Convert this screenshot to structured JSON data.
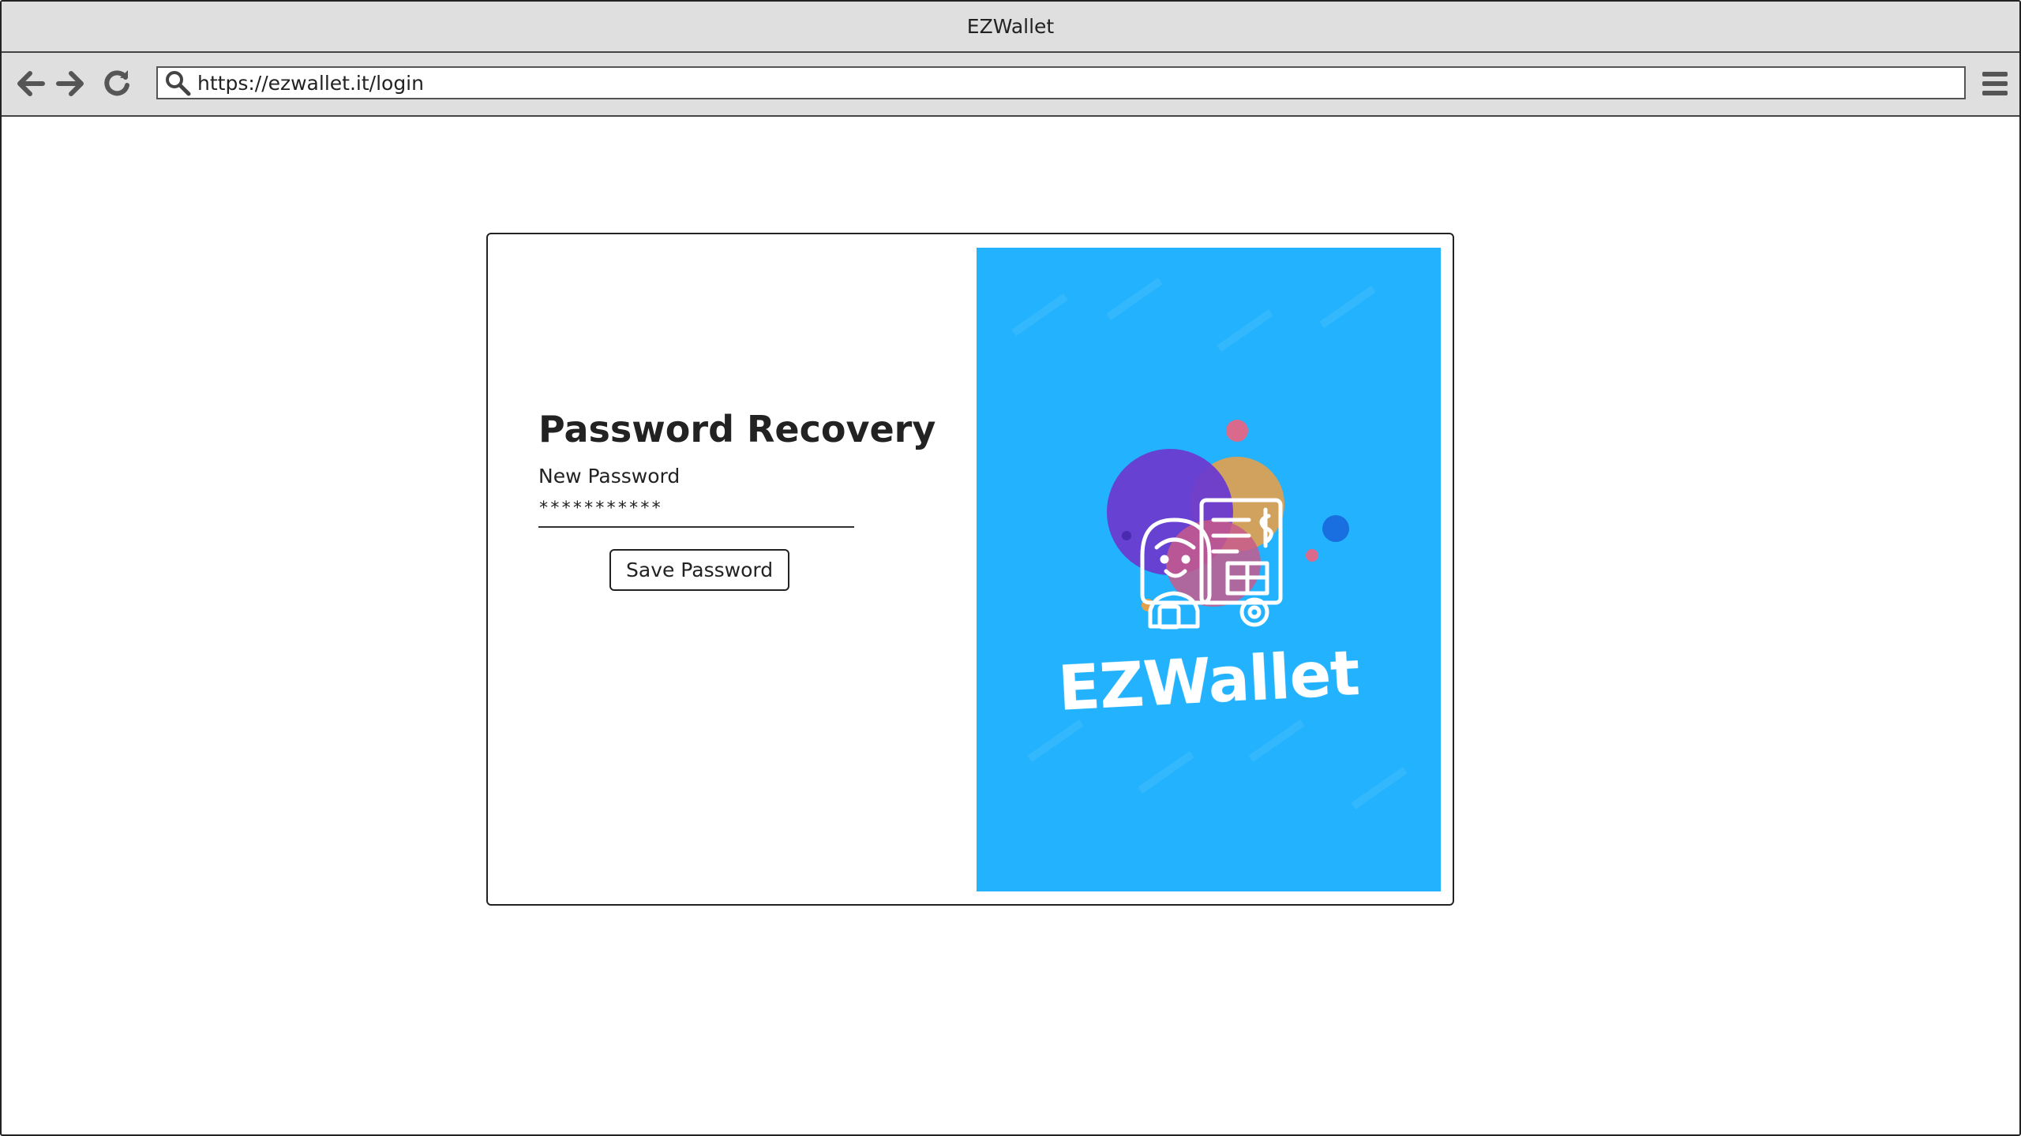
{
  "window": {
    "title": "EZWallet"
  },
  "toolbar": {
    "url": "https://ezwallet.it/login",
    "back_icon": "arrow-left-icon",
    "forward_icon": "arrow-right-icon",
    "reload_icon": "reload-icon",
    "search_icon": "search-icon",
    "menu_icon": "hamburger-menu-icon"
  },
  "form": {
    "title": "Password Recovery",
    "new_password_label": "New Password",
    "new_password_value": "***********",
    "save_button_label": "Save Password"
  },
  "brand": {
    "name": "EZWallet",
    "panel_color": "#23b2fd",
    "illustration": "woman-with-finance-document-icon"
  }
}
